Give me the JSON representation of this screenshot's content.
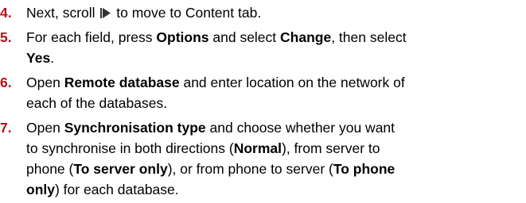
{
  "steps": [
    {
      "number": "4.",
      "lines": [
        [
          "Next, scroll ",
          " to move to Content tab."
        ]
      ],
      "icon": "right-arrow-icon"
    },
    {
      "number": "5.",
      "lines": [
        [
          "For each field, press ",
          "Options",
          " and select ",
          "Change",
          ", then select"
        ],
        [
          "Yes",
          "."
        ]
      ]
    },
    {
      "number": "6.",
      "lines": [
        [
          "Open ",
          "Remote database",
          " and enter location on the network of"
        ],
        [
          "each of the databases."
        ]
      ]
    },
    {
      "number": "7.",
      "lines": [
        [
          "Open ",
          "Synchronisation type",
          " and choose whether you want"
        ],
        [
          "to synchronise in both directions (",
          "Normal",
          "), from server to"
        ],
        [
          "phone (",
          "To server only",
          "), or from phone to server (",
          "To phone"
        ],
        [
          "only",
          ") for each database."
        ]
      ]
    }
  ]
}
